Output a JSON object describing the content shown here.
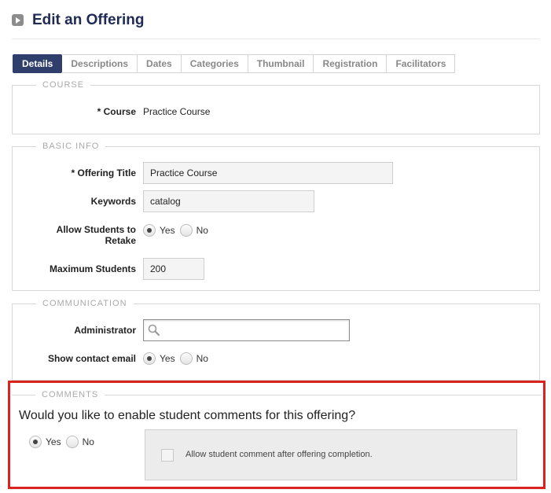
{
  "header": {
    "title": "Edit an Offering"
  },
  "tabs": [
    "Details",
    "Descriptions",
    "Dates",
    "Categories",
    "Thumbnail",
    "Registration",
    "Facilitators"
  ],
  "course": {
    "legend": "COURSE",
    "course_label": "* Course",
    "course_value": "Practice Course"
  },
  "basic_info": {
    "legend": "BASIC INFO",
    "title_label": "* Offering Title",
    "title_value": "Practice Course",
    "keywords_label": "Keywords",
    "keywords_value": "catalog",
    "retake_label_line1": "Allow Students to",
    "retake_label_line2": "Retake",
    "retake_yes": "Yes",
    "retake_no": "No",
    "max_label": "Maximum Students",
    "max_value": "200"
  },
  "communication": {
    "legend": "COMMUNICATION",
    "admin_label": "Administrator",
    "admin_value": "",
    "email_label": "Show contact email",
    "email_yes": "Yes",
    "email_no": "No"
  },
  "comments": {
    "legend": "COMMENTS",
    "question": "Would you like to enable student comments for this offering?",
    "yes": "Yes",
    "no": "No",
    "after_completion_label": "Allow student comment after offering completion."
  },
  "colors": {
    "title": "#1f2a55",
    "active_tab": "#2f3e6b",
    "highlight": "#d8261e"
  }
}
